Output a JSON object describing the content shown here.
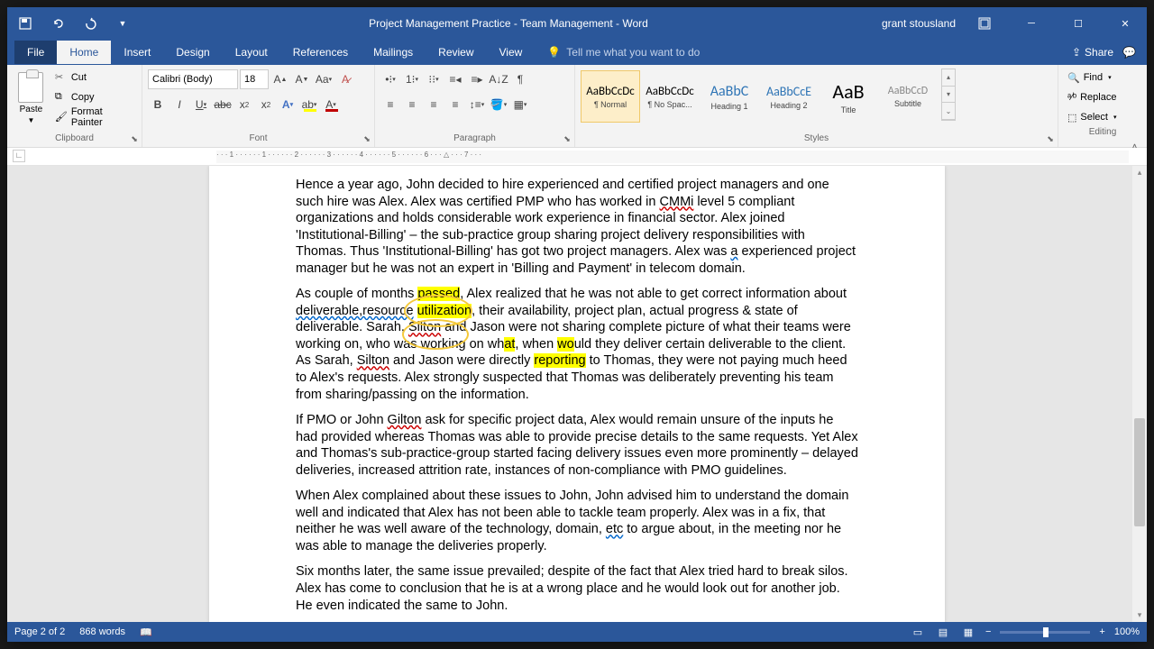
{
  "titlebar": {
    "title": "Project Management Practice - Team Management  -  Word",
    "user": "grant stousland"
  },
  "tabs": {
    "file": "File",
    "home": "Home",
    "insert": "Insert",
    "design": "Design",
    "layout": "Layout",
    "references": "References",
    "mailings": "Mailings",
    "review": "Review",
    "view": "View",
    "tellme": "Tell me what you want to do",
    "share": "Share"
  },
  "clipboard": {
    "paste": "Paste",
    "cut": "Cut",
    "copy": "Copy",
    "format_painter": "Format Painter",
    "label": "Clipboard"
  },
  "font": {
    "name": "Calibri (Body)",
    "size": "18",
    "label": "Font"
  },
  "paragraph": {
    "label": "Paragraph"
  },
  "styles": {
    "label": "Styles",
    "items": [
      {
        "preview": "AaBbCcDc",
        "name": "¶ Normal",
        "cls": "sp-normal"
      },
      {
        "preview": "AaBbCcDc",
        "name": "¶ No Spac...",
        "cls": "sp-nospace"
      },
      {
        "preview": "AaBbC",
        "name": "Heading 1",
        "cls": "sp-h1"
      },
      {
        "preview": "AaBbCcE",
        "name": "Heading 2",
        "cls": "sp-h2"
      },
      {
        "preview": "AaB",
        "name": "Title",
        "cls": "sp-title"
      },
      {
        "preview": "AaBbCcD",
        "name": "Subtitle",
        "cls": "sp-sub"
      }
    ]
  },
  "editing": {
    "find": "Find",
    "replace": "Replace",
    "select": "Select",
    "label": "Editing"
  },
  "document": {
    "p1_a": "Hence a year ago, John decided to hire experienced and certified project managers and one such hire was Alex. Alex was certified PMP who has worked in ",
    "p1_cmmi": "CMMi",
    "p1_b": " level 5 compliant organizations and holds considerable work experience in financial sector. Alex joined 'Institutional-Billing' – the sub-practice group sharing project delivery responsibilities with Thomas. Thus 'Institutional-Billing' has got two project managers. Alex was ",
    "p1_a2": "a",
    "p1_c": " experienced project manager but he was not an expert in 'Billing and Payment' in telecom domain.",
    "p2_a": "As couple of months ",
    "p2_passed": "passed",
    "p2_b": ", Alex realized that he was not able to get correct information about ",
    "p2_dru": "deliverable,resource",
    "p2_sp": " ",
    "p2_util": "utilization",
    "p2_c": ", their availability, project plan, actual progress & state of deliverable. Sarah, ",
    "p2_silton1": "Silton",
    "p2_d": " and ",
    "p2_jason": "Jason",
    "p2_d2": " were not sharing complete picture of what their teams were working on, who was working on wh",
    "p2_at": "at",
    "p2_e": ", when ",
    "p2_wo": "wo",
    "p2_f": "uld they deliver certain deliverable to the client. As Sarah, ",
    "p2_silton2": "Silton",
    "p2_g": " and Jason were directly ",
    "p2_rep": "reporting",
    "p2_h": " to Thomas, they were not paying much heed to Alex's requests. Alex strongly suspected that Thomas was deliberately preventing his team from sharing/passing on the information.",
    "p3_a": "If PMO or John ",
    "p3_gilton": "Gilton",
    "p3_b": " ask for specific project data, Alex would remain unsure of the inputs he had provided whereas Thomas was able to provide precise details to the same requests. Yet Alex and Thomas's sub-practice-group started facing delivery issues even more prominently – delayed deliveries, increased attrition rate, instances of non-compliance with PMO guidelines.",
    "p4_a": "When Alex complained about these issues to John, John advised him to understand the domain well and indicated that Alex has not been able to tackle team properly. Alex was in a fix, that neither he was well aware of the technology, domain, ",
    "p4_etc": "etc",
    "p4_b": " to argue about, in the meeting nor he was able to manage the deliveries properly.",
    "p5": "Six months later, the same issue prevailed; despite of the fact that Alex tried hard to break silos. Alex has come to conclusion that he is at a wrong place and he would look out for another job. He even indicated the same to John."
  },
  "status": {
    "page": "Page 2 of 2",
    "words": "868 words",
    "zoom": "100%"
  }
}
